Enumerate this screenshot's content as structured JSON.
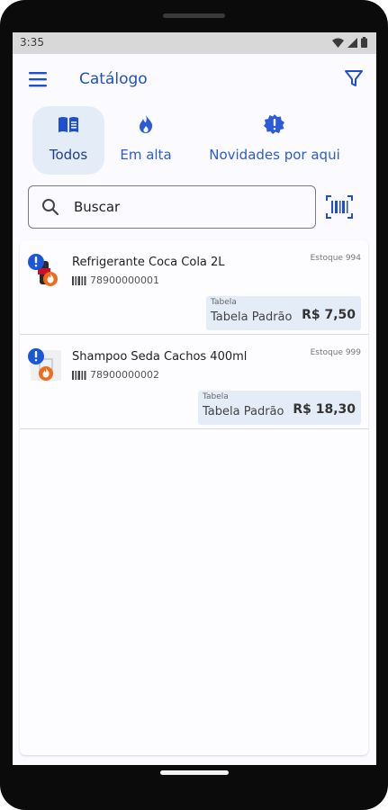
{
  "status_bar": {
    "time": "3:35"
  },
  "app_bar": {
    "title": "Catálogo"
  },
  "tabs": [
    {
      "label": "Todos",
      "icon": "book-open-icon",
      "active": true
    },
    {
      "label": "Em alta",
      "icon": "flame-icon",
      "active": false
    },
    {
      "label": "Novidades por aqui",
      "icon": "new-badge-icon",
      "active": false
    }
  ],
  "search": {
    "placeholder": "Buscar",
    "value": ""
  },
  "products": [
    {
      "name": "Refrigerante Coca Cola 2L",
      "code": "78900000001",
      "stock": "Estoque 994",
      "table_label": "Tabela",
      "table_name": "Tabela Padrão",
      "price": "R$ 7,50"
    },
    {
      "name": "Shampoo Seda Cachos 400ml",
      "code": "78900000002",
      "stock": "Estoque 999",
      "table_label": "Tabela",
      "table_name": "Tabela Padrão",
      "price": "R$ 18,30"
    }
  ],
  "colors": {
    "accent": "#1f4fd1",
    "tab_active_bg": "#e4ecf8",
    "badge_blue": "#1a56db",
    "badge_orange": "#f26b1d"
  }
}
